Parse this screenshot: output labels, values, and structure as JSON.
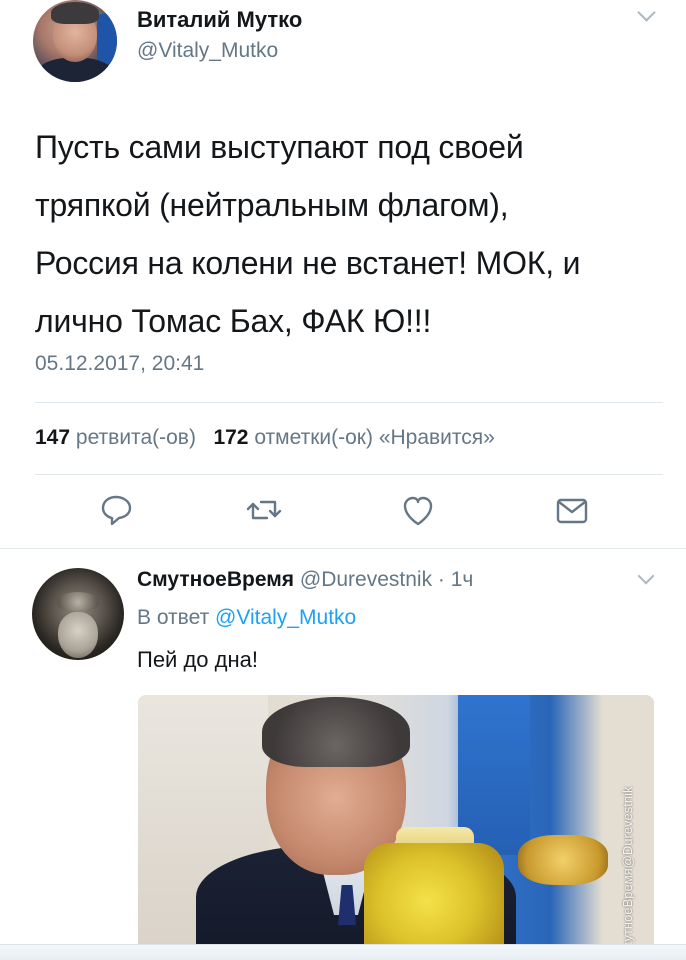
{
  "main_tweet": {
    "author_name": "Виталий Мутко",
    "author_handle": "@Vitaly_Mutko",
    "text_lines": [
      "Пусть сами выступают под своей",
      "тряпкой (нейтральным флагом),",
      "Россия на колени не встанет! МОК, и",
      "лично Томас Бах, ФАК Ю!!!"
    ],
    "timestamp": "05.12.2017, 20:41",
    "retweet_count": "147",
    "retweet_label": "ретвита(-ов)",
    "like_count": "172",
    "like_label": "отметки(-ок) «Нравится»",
    "actions": [
      "reply-icon",
      "retweet-icon",
      "like-icon",
      "direct-message-icon"
    ]
  },
  "reply_tweet": {
    "author_name": "СмутноеВремя",
    "author_handle": "@Durevestnik",
    "time": "· 1ч",
    "reply_prefix": "В ответ",
    "reply_mention": "@Vitaly_Mutko",
    "text": "Пей до дна!",
    "media_watermark": "СмутноеВремя@Durevestnik"
  },
  "colors": {
    "text": "#14171a",
    "secondary": "#657786",
    "link": "#1da1f2",
    "divider": "#e1e8ed"
  }
}
